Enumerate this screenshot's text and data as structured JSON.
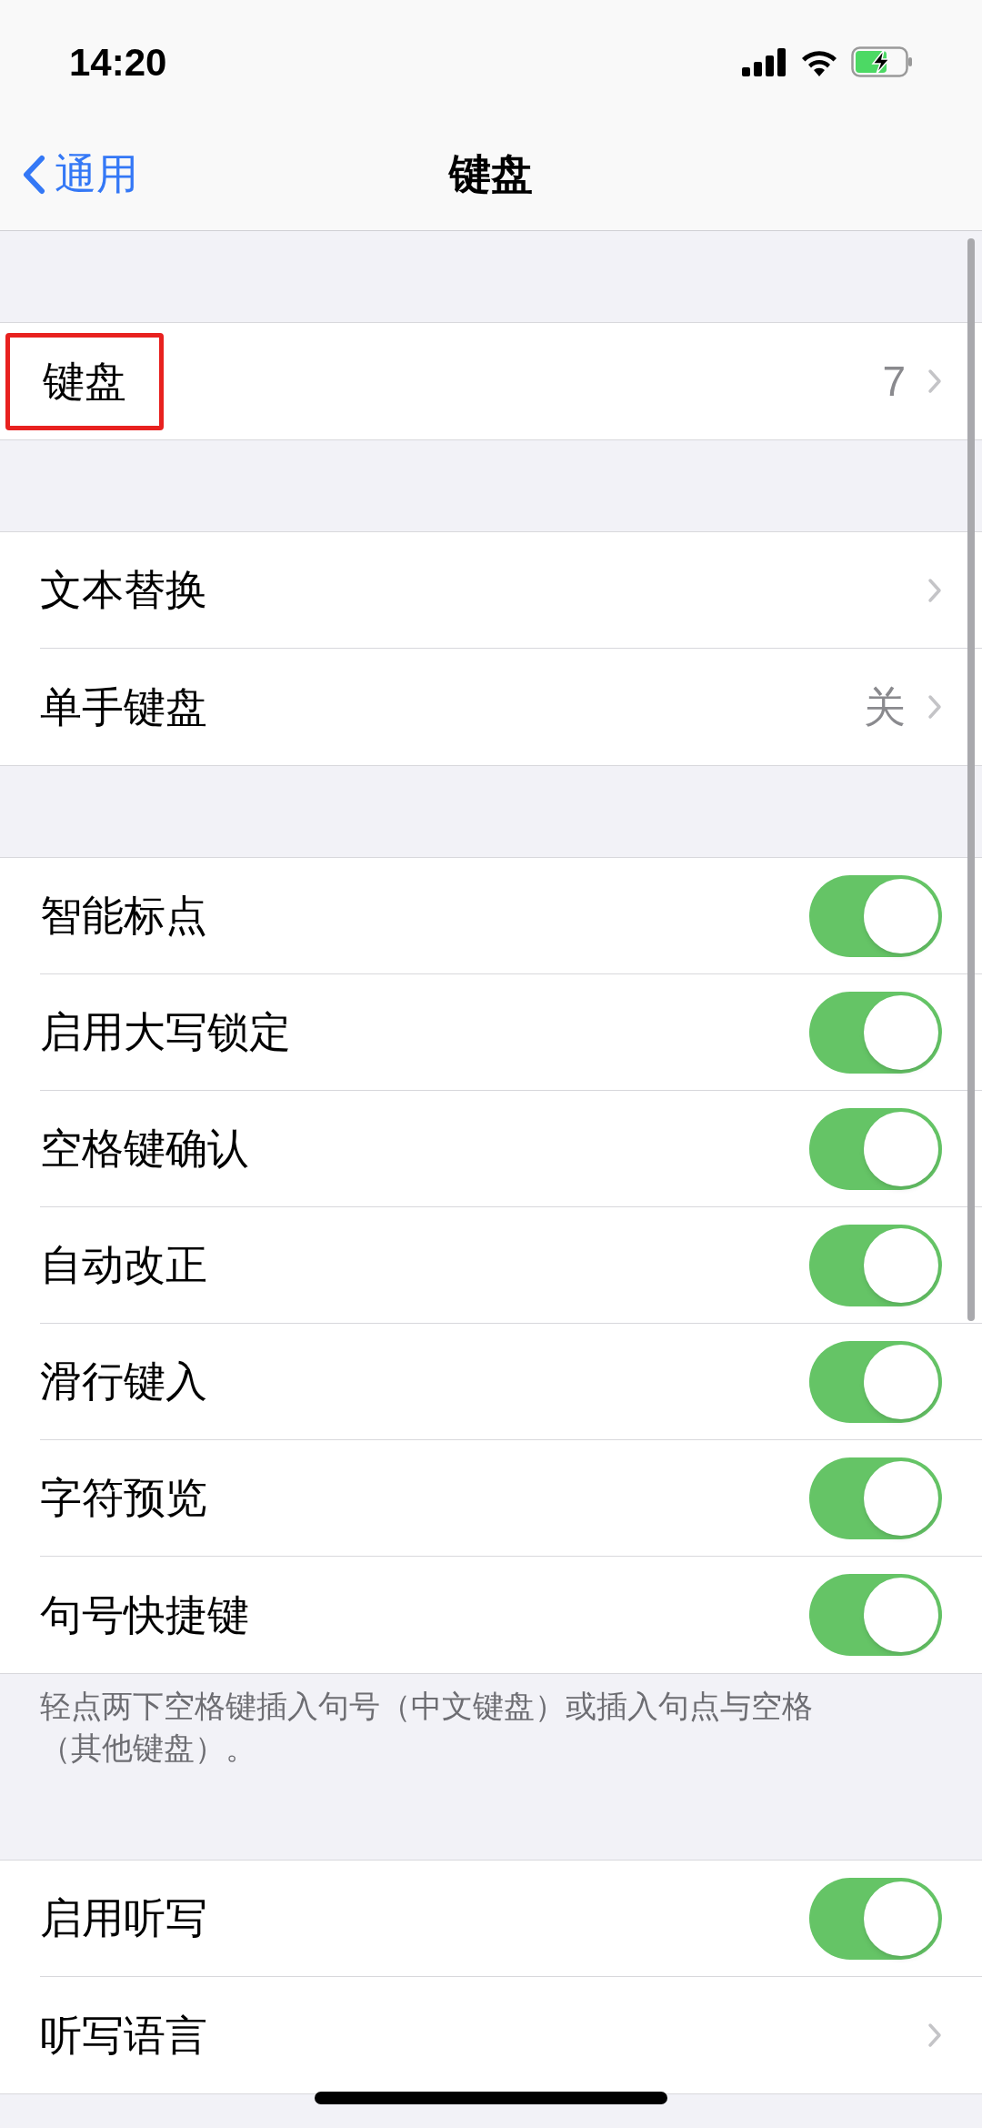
{
  "status_bar": {
    "time": "14:20",
    "charging": true
  },
  "nav": {
    "back": "通用",
    "title": "键盘"
  },
  "sections": [
    {
      "rows": [
        {
          "kind": "link",
          "label": "键盘",
          "value": "7",
          "highlighted": true
        }
      ]
    },
    {
      "rows": [
        {
          "kind": "link",
          "label": "文本替换",
          "highlighted": false
        },
        {
          "kind": "link",
          "label": "单手键盘",
          "value": "关",
          "highlighted": false
        }
      ]
    },
    {
      "rows": [
        {
          "kind": "toggle",
          "label": "智能标点",
          "on": true
        },
        {
          "kind": "toggle",
          "label": "启用大写锁定",
          "on": true
        },
        {
          "kind": "toggle",
          "label": "空格键确认",
          "on": true
        },
        {
          "kind": "toggle",
          "label": "自动改正",
          "on": true
        },
        {
          "kind": "toggle",
          "label": "滑行键入",
          "on": true
        },
        {
          "kind": "toggle",
          "label": "字符预览",
          "on": true
        },
        {
          "kind": "toggle",
          "label": "句号快捷键",
          "on": true
        }
      ],
      "footer": "轻点两下空格键插入句号（中文键盘）或插入句点与空格（其他键盘）。"
    },
    {
      "rows": [
        {
          "kind": "toggle",
          "label": "启用听写",
          "on": true
        },
        {
          "kind": "link",
          "label": "听写语言",
          "highlighted": false
        }
      ]
    }
  ]
}
